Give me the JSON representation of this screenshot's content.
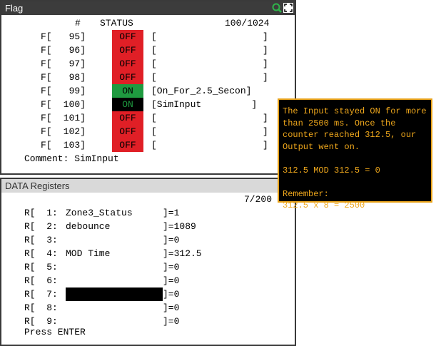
{
  "flag_panel": {
    "title": "Flag",
    "header": {
      "num_label": "#",
      "status_label": "STATUS",
      "page_count": "100/1024"
    },
    "rows": [
      {
        "prefix": "F[",
        "index": "95]",
        "status": "OFF",
        "comment": "[                   ]"
      },
      {
        "prefix": "F[",
        "index": "96]",
        "status": "OFF",
        "comment": "[                   ]"
      },
      {
        "prefix": "F[",
        "index": "97]",
        "status": "OFF",
        "comment": "[                   ]"
      },
      {
        "prefix": "F[",
        "index": "98]",
        "status": "OFF",
        "comment": "[                   ]"
      },
      {
        "prefix": "F[",
        "index": "99]",
        "status": "ON",
        "comment": "[On_For_2.5_Secon]"
      },
      {
        "prefix": "F[",
        "index": "100]",
        "status": "ON",
        "comment": "[SimInput         ]"
      },
      {
        "prefix": "F[",
        "index": "101]",
        "status": "OFF",
        "comment": "[                   ]"
      },
      {
        "prefix": "F[",
        "index": "102]",
        "status": "OFF",
        "comment": "[                   ]"
      },
      {
        "prefix": "F[",
        "index": "103]",
        "status": "OFF",
        "comment": "[                   ]"
      }
    ],
    "comment_line": "Comment: SimInput"
  },
  "data_panel": {
    "title": "DATA Registers",
    "page_count": "7/200",
    "rows": [
      {
        "label": "R[  1:",
        "name": "Zone3_Status",
        "value": "]=1"
      },
      {
        "label": "R[  2:",
        "name": "debounce",
        "value": "]=1089"
      },
      {
        "label": "R[  3:",
        "name": "",
        "value": "]=0"
      },
      {
        "label": "R[  4:",
        "name": "MOD Time",
        "value": "]=312.5"
      },
      {
        "label": "R[  5:",
        "name": "",
        "value": "]=0"
      },
      {
        "label": "R[  6:",
        "name": "",
        "value": "]=0"
      },
      {
        "label": "R[  7:",
        "name": "",
        "value": "]=0"
      },
      {
        "label": "R[  8:",
        "name": "",
        "value": "]=0"
      },
      {
        "label": "R[  9:",
        "name": "",
        "value": "]=0"
      }
    ],
    "prompt": "Press ENTER"
  },
  "tooltip": {
    "lines": [
      "The Input stayed ON for more",
      "than 2500 ms. Once the",
      "counter reached 312.5, our",
      "Output went on.",
      "",
      "312.5 MOD 312.5 = 0",
      "",
      "Remember:",
      "312.5 x 8 = 2500"
    ]
  },
  "colors": {
    "off": "#e01f26",
    "on": "#1f9a40",
    "tooltip_text": "#f0a81c",
    "tooltip_border": "#e8a21a"
  }
}
